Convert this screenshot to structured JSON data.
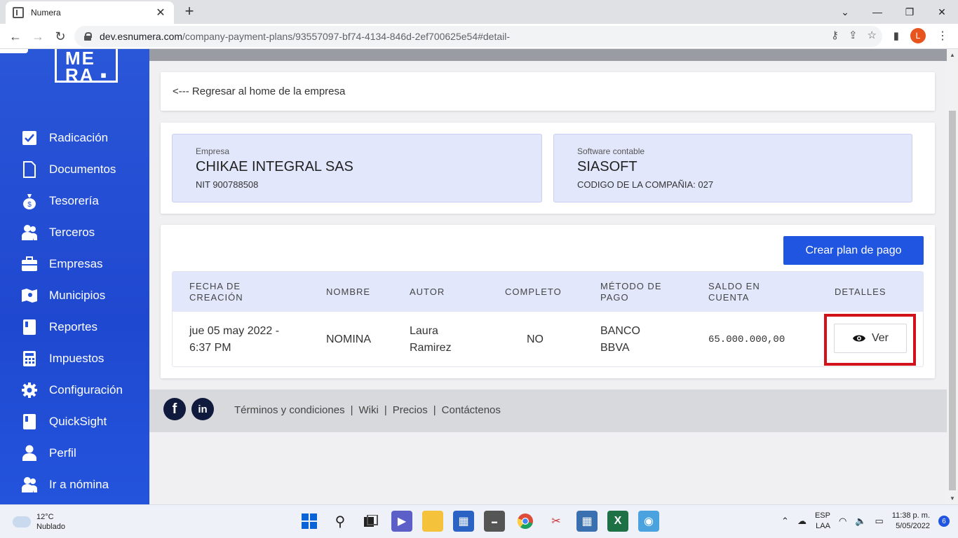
{
  "browser": {
    "tab_title": "Numera",
    "tab_close": "✕",
    "new_tab": "+",
    "url_host": "dev.esnumera.com",
    "url_path": "/company-payment-plans/93557097-bf74-4134-846d-2ef700625e54#detail-",
    "profile_initial": "L"
  },
  "sidebar": {
    "logo_line1": "ME",
    "logo_line2": "RA",
    "items": [
      {
        "label": "Radicación",
        "icon": "checkbox-icon"
      },
      {
        "label": "Documentos",
        "icon": "document-icon"
      },
      {
        "label": "Tesorería",
        "icon": "money-bag-icon"
      },
      {
        "label": "Terceros",
        "icon": "people-icon"
      },
      {
        "label": "Empresas",
        "icon": "briefcase-icon"
      },
      {
        "label": "Municipios",
        "icon": "map-icon"
      },
      {
        "label": "Reportes",
        "icon": "book-icon"
      },
      {
        "label": "Impuestos",
        "icon": "calculator-icon"
      },
      {
        "label": "Configuración",
        "icon": "gear-icon"
      },
      {
        "label": "QuickSight",
        "icon": "book-icon"
      },
      {
        "label": "Perfil",
        "icon": "user-icon"
      },
      {
        "label": "Ir a nómina",
        "icon": "people-icon"
      }
    ]
  },
  "main": {
    "back_link": "<--- Regresar al home de la empresa",
    "company": {
      "label": "Empresa",
      "name": "CHIKAE INTEGRAL SAS",
      "nit": "NIT 900788508"
    },
    "software": {
      "label": "Software contable",
      "name": "SIASOFT",
      "code": "CODIGO DE LA COMPAÑIA: 027"
    },
    "create_button": "Crear plan de pago",
    "table": {
      "headers": [
        "FECHA DE CREACIÓN",
        "NOMBRE",
        "AUTOR",
        "COMPLETO",
        "MÉTODO DE PAGO",
        "SALDO EN CUENTA",
        "DETALLES"
      ],
      "rows": [
        {
          "fecha": "jue 05 may 2022 - 6:37 PM",
          "nombre": "NOMINA",
          "autor": "Laura Ramirez",
          "completo": "NO",
          "metodo": "BANCO BBVA",
          "saldo": "65.000.000,00",
          "detalle": "Ver"
        }
      ]
    }
  },
  "footer": {
    "links": [
      "Términos y condiciones",
      "Wiki",
      "Precios",
      "Contáctenos"
    ],
    "separator": "|",
    "facebook": "f",
    "linkedin": "in"
  },
  "taskbar": {
    "temperature": "12°C",
    "weather": "Nublado",
    "language": "ESP",
    "layout": "LAA",
    "time": "11:38 p. m.",
    "date": "5/05/2022",
    "notifications": "6"
  },
  "colors": {
    "accent": "#1f55e0",
    "highlight": "#d1121b",
    "sidebar": "#2452d8"
  }
}
